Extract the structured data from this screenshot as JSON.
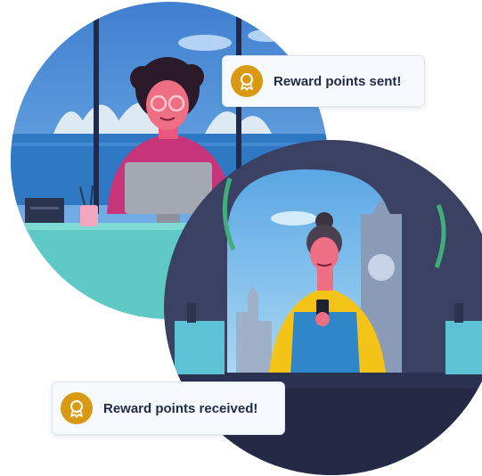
{
  "notifications": [
    {
      "text": "Reward points sent!",
      "icon": "award-medal-icon"
    },
    {
      "text": "Reward points received!",
      "icon": "award-medal-icon"
    }
  ],
  "colors": {
    "badge": "#d99a12",
    "toast_background": "#f6f9fd",
    "toast_text": "#1f2a44",
    "office_sky": "#4a8fd4",
    "shop_frame": "#3a4163"
  }
}
